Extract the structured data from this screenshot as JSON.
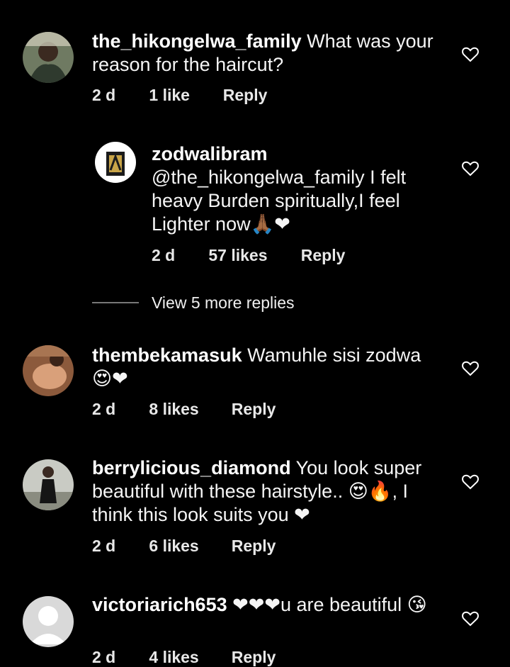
{
  "comments": [
    {
      "username": "the_hikongelwa_family",
      "text": "What was your reason for the haircut?",
      "time": "2 d",
      "likes": "1 like",
      "reply": "Reply",
      "avatar": "user-photo"
    },
    {
      "username": "zodwalibram",
      "text": "@the_hikongelwa_family I felt heavy Burden spiritually,I feel Lighter now🙏🏾❤",
      "time": "2 d",
      "likes": "57 likes",
      "reply": "Reply",
      "avatar": "brand-logo-photo"
    },
    {
      "username": "thembekamasuk",
      "text": "Wamuhle sisi zodwa 😍❤",
      "time": "2 d",
      "likes": "8 likes",
      "reply": "Reply",
      "avatar": "user-photo"
    },
    {
      "username": "berrylicious_diamond",
      "text": "You look super beautiful with these hairstyle.. 😍🔥, I think this look suits you ❤",
      "time": "2 d",
      "likes": "6 likes",
      "reply": "Reply",
      "avatar": "user-photo"
    },
    {
      "username": "victoriarich653",
      "text": "❤❤❤u are beautiful 😘",
      "time": "2 d",
      "likes": "4 likes",
      "reply": "Reply",
      "avatar": "default-avatar"
    }
  ],
  "view_more": "View 5 more replies",
  "colors": {
    "background": "#000000",
    "text": "#ffffff",
    "muted": "#777777"
  }
}
